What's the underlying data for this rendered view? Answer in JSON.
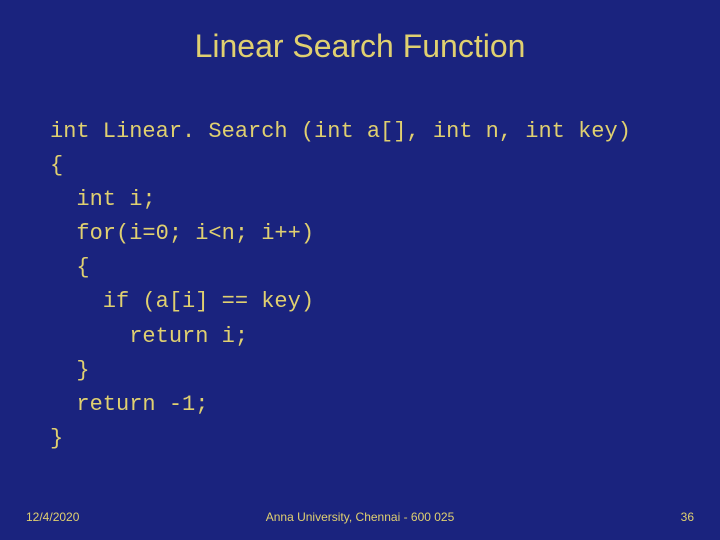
{
  "title": "Linear Search Function",
  "code": {
    "l1": "int Linear. Search (int a[], int n, int key)",
    "l2": "{",
    "l3": "  int i;",
    "l4": "  for(i=0; i<n; i++)",
    "l5": "  {",
    "l6": "    if (a[i] == key)",
    "l7": "      return i;",
    "l8": "  }",
    "l9": "  return -1;",
    "l10": "}"
  },
  "footer": {
    "date": "12/4/2020",
    "org": "Anna University, Chennai - 600 025",
    "page": "36"
  }
}
